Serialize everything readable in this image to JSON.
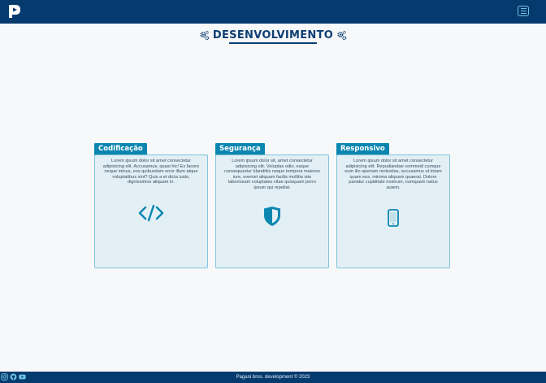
{
  "section": {
    "title": "DESENVOLVIMENTO"
  },
  "cards": [
    {
      "title": "Codificação",
      "text": "Lorem ipsum dolor sit amet consectetur adipisicing elit. Accusamus, quasi hic! Ex facere neque minus, eos quibusdam error illum atque voluptatibus sint? Quis a et dicta iusto, dignissimos aliquam in.",
      "icon": "code-icon"
    },
    {
      "title": "Segurança",
      "text": "Lorem ipsum dolor sit, amet consectetur adipisicing elit. Voluptas odio, eaque consequuntur blanditiis neque tempora maiores iure, eveniet aliquam facilis mollitia iste laboriosam voluptates vitae quisquam porro ipsum qui repellat.",
      "icon": "shield-icon"
    },
    {
      "title": "Responsivo",
      "text": "Lorem ipsum dolor sit amet consectetur adipisicing elit. Repudiandae commodi cumque eum illo aperiam molestias, accusamus ut totam quam eos, minima aliquam quaerat. Dolore pariatur cupiditate nostrum, numquam natus autem.",
      "icon": "smartphone-icon"
    }
  ],
  "footer": {
    "text": "Pagani bros. development © 2023",
    "icons": [
      "instagram-icon",
      "github-icon",
      "youtube-icon"
    ]
  },
  "colors": {
    "header_bg": "#053a6e",
    "accent": "#0b86b0",
    "card_bg": "#e2f0f6",
    "card_border": "#7fc3dc"
  }
}
